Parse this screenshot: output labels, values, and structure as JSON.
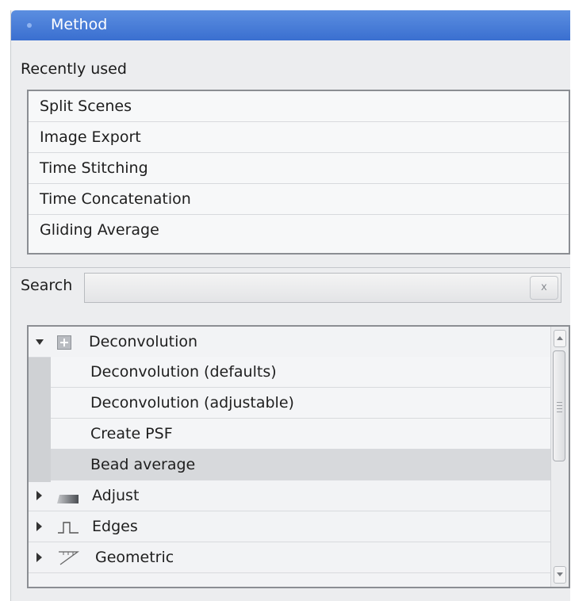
{
  "panel": {
    "title": "Method"
  },
  "recent": {
    "label": "Recently used",
    "items": [
      "Split Scenes",
      "Image Export",
      "Time Stitching",
      "Time Concatenation",
      "Gliding Average"
    ]
  },
  "search": {
    "label": "Search",
    "value": "",
    "clear_label": "x"
  },
  "tree": {
    "groups": [
      {
        "label": "Deconvolution",
        "expanded": true,
        "icon": "plus-box-icon",
        "children": [
          "Deconvolution (defaults)",
          "Deconvolution (adjustable)",
          "Create PSF",
          "Bead average"
        ],
        "selected_child": "Bead average"
      },
      {
        "label": "Adjust",
        "expanded": false,
        "icon": "gradient-block-icon"
      },
      {
        "label": "Edges",
        "expanded": false,
        "icon": "edge-profile-icon"
      },
      {
        "label": "Geometric",
        "expanded": false,
        "icon": "ruler-angle-icon"
      }
    ]
  },
  "colors": {
    "title_bar": "#3a6fd0",
    "selected_row": "#d7d9dc",
    "panel_bg": "#ecedef"
  }
}
